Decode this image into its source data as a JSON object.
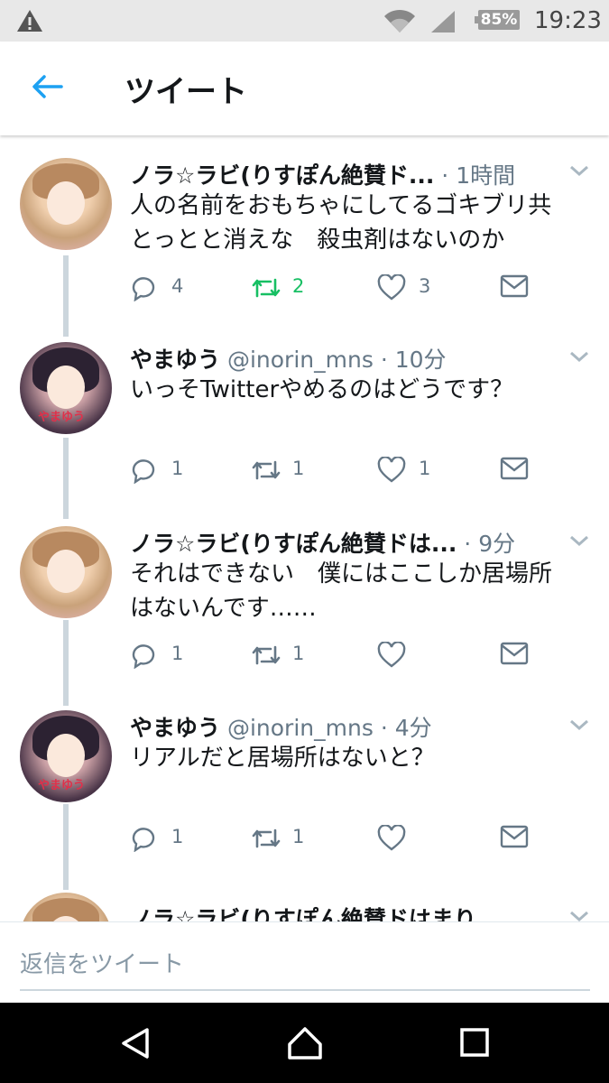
{
  "status_bar": {
    "battery": "85%",
    "time": "19:23",
    "icons": [
      "warning-icon",
      "wifi-icon",
      "cell-signal-icon",
      "battery-icon"
    ]
  },
  "app_bar": {
    "title": "ツイート",
    "back_icon": "arrow-left-icon"
  },
  "tweets": [
    {
      "name": "ノラ☆ラビ(りすぽん絶賛ド...",
      "handle": "",
      "time": "1時間",
      "text_lines": [
        "人の名前をおもちゃにしてるゴキブリ共",
        "とっとと消えな　殺虫剤はないのか"
      ],
      "reply_count": "4",
      "retweet_count": "2",
      "like_count": "3",
      "retweeted": true
    },
    {
      "name": "やまゆう",
      "handle": "@inorin_mns",
      "time": "10分",
      "text_lines": [
        "いっそTwitterやめるのはどうです？"
      ],
      "reply_count": "1",
      "retweet_count": "1",
      "like_count": "1",
      "avatar_text": "やまゆう"
    },
    {
      "name": "ノラ☆ラビ(りすぽん絶賛ドは...",
      "handle": "",
      "time": "9分",
      "text_lines": [
        "それはできない　僕にはここしか居場所",
        "はないんです……"
      ],
      "reply_count": "1",
      "retweet_count": "1",
      "like_count": ""
    },
    {
      "name": "やまゆう",
      "handle": "@inorin_mns",
      "time": "4分",
      "text_lines": [
        "リアルだと居場所はないと？"
      ],
      "reply_count": "1",
      "retweet_count": "1",
      "like_count": "",
      "avatar_text": "やまゆう"
    },
    {
      "name": "ノラ☆ラビ(りすぽん絶賛ドはまり",
      "handle": "",
      "time": ""
    }
  ],
  "reply_input": {
    "placeholder": "返信をツイート"
  },
  "colors": {
    "retweet_active": "#17bf63",
    "back_arrow": "#1da1f2",
    "thread_line": "#ccd6dd",
    "meta_text": "#657786"
  }
}
